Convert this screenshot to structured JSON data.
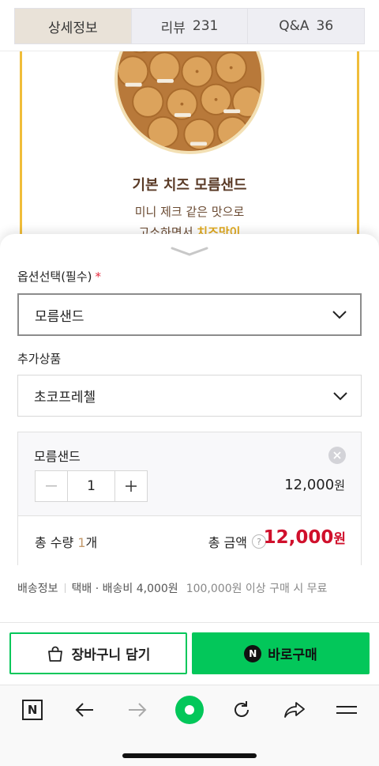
{
  "tabs": [
    {
      "label": "상세정보",
      "count": ""
    },
    {
      "label": "리뷰",
      "count": "231"
    },
    {
      "label": "Q&A",
      "count": "36"
    }
  ],
  "product": {
    "title": "기본 치즈 모름샌드",
    "desc_line1": "미니 제크 같은 맛으로",
    "desc_line2_pre": "고소하면서 ",
    "desc_line2_hl": "치즈맛이"
  },
  "option": {
    "label": "옵션선택(필수)",
    "required_mark": "*",
    "selected": "모름샌드"
  },
  "addon": {
    "label": "추가상품",
    "selected": "초코프레첼"
  },
  "selection": {
    "name": "모름샌드",
    "quantity": "1",
    "price": "12,000",
    "price_unit": "원"
  },
  "total": {
    "qty_label": "총 수량",
    "qty_value": "1",
    "qty_unit": "개",
    "amount_label": "총 금액",
    "help": "?",
    "amount": "12,000",
    "amount_unit": "원"
  },
  "shipping": {
    "label": "배송정보",
    "method": "택배 · 배송비 4,000원",
    "free_note": "100,000원 이상 구매 시 무료"
  },
  "buttons": {
    "cart": "장바구니 담기",
    "buy": "바로구매",
    "buy_badge": "N"
  },
  "toolbar": {
    "n_label": "N",
    "icons": [
      "naver-icon",
      "back-arrow-icon",
      "forward-arrow-icon",
      "home-icon",
      "refresh-icon",
      "share-icon",
      "menu-icon"
    ]
  },
  "colors": {
    "accent_green": "#03c75a",
    "price_red": "#d0102c",
    "frame_gold": "#f0bd3a",
    "tab_active_bg": "#e9e2d8"
  }
}
